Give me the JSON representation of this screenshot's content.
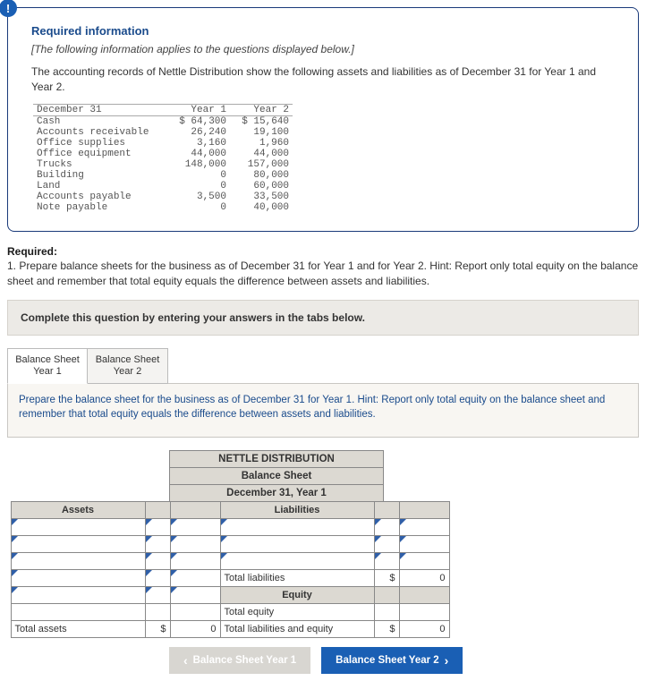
{
  "info": {
    "badge": "!",
    "title": "Required information",
    "note": "[The following information applies to the questions displayed below.]",
    "intro": "The accounting records of Nettle Distribution show the following assets and liabilities as of December 31 for Year 1 and Year 2.",
    "table": {
      "h0": "December 31",
      "h1": "Year 1",
      "h2": "Year 2",
      "rows": [
        {
          "l": "Cash",
          "a": "$ 64,300",
          "b": "$ 15,640"
        },
        {
          "l": "Accounts receivable",
          "a": "26,240",
          "b": "19,100"
        },
        {
          "l": "Office supplies",
          "a": "3,160",
          "b": "1,960"
        },
        {
          "l": "Office equipment",
          "a": "44,000",
          "b": "44,000"
        },
        {
          "l": "Trucks",
          "a": "148,000",
          "b": "157,000"
        },
        {
          "l": "Building",
          "a": "0",
          "b": "80,000"
        },
        {
          "l": "Land",
          "a": "0",
          "b": "60,000"
        },
        {
          "l": "Accounts payable",
          "a": "3,500",
          "b": "33,500"
        },
        {
          "l": "Note payable",
          "a": "0",
          "b": "40,000"
        }
      ]
    }
  },
  "required": {
    "head": "Required:",
    "text": "1. Prepare balance sheets for the business as of December 31 for Year 1 and for Year 2. Hint: Report only total equity on the balance sheet and remember that total equity equals the difference between assets and liabilities."
  },
  "graybar": "Complete this question by entering your answers in the tabs below.",
  "tabs": {
    "t1a": "Balance Sheet",
    "t1b": "Year 1",
    "t2a": "Balance Sheet",
    "t2b": "Year 2"
  },
  "panel": {
    "hint": "Prepare the balance sheet for the business as of December 31 for Year 1. Hint: Report only total equity on the balance sheet and remember that total equity equals the difference between assets and liabilities."
  },
  "bs": {
    "t1": "NETTLE DISTRIBUTION",
    "t2": "Balance Sheet",
    "t3": "December 31, Year 1",
    "assets": "Assets",
    "liab": "Liabilities",
    "totliab": "Total liabilities",
    "equity": "Equity",
    "toteq": "Total equity",
    "totassets": "Total assets",
    "tle": "Total liabilities and equity",
    "cur": "$",
    "zero": "0"
  },
  "nav": {
    "prev": "Balance Sheet Year 1",
    "next": "Balance Sheet Year 2"
  }
}
